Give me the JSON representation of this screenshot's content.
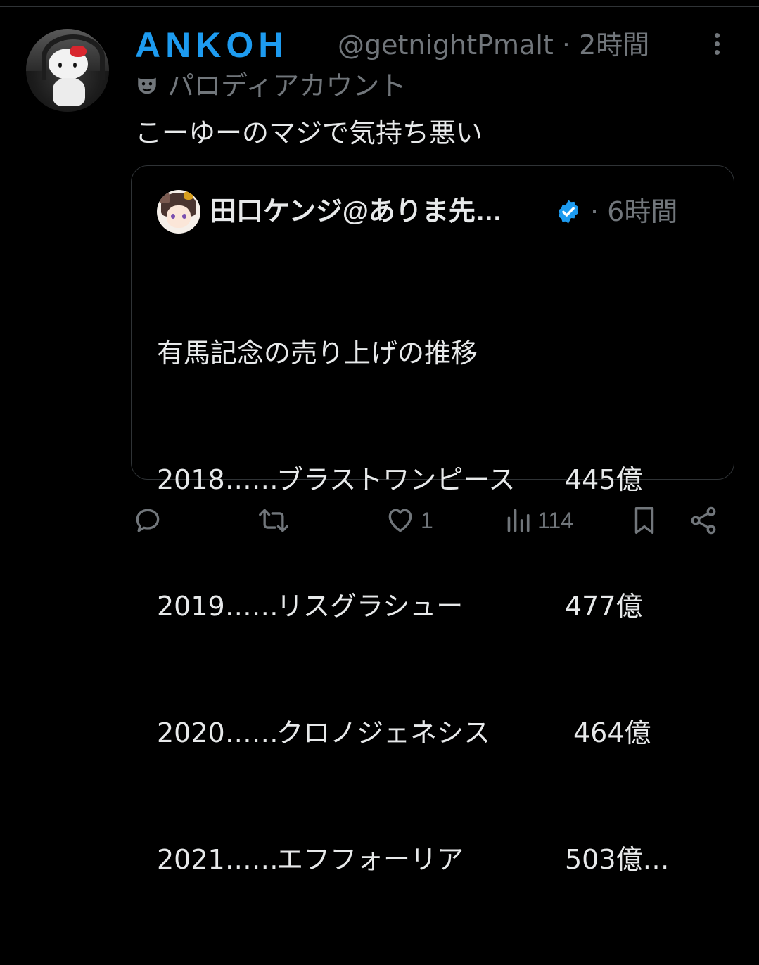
{
  "post": {
    "author": {
      "display_name": "ANKOH",
      "handle": "@getnightPmalt",
      "time": "2時間",
      "label": "パロディアカウント"
    },
    "text": "こーゆーのマジで気持ち悪い",
    "actions": {
      "reply_count": "",
      "repost_count": "",
      "like_count": "1",
      "view_count": "114"
    }
  },
  "quoted": {
    "author": {
      "display_name": "田口ケンジ@ありま先…",
      "time": "6時間",
      "verified_color": "#1d9bf0"
    },
    "heading": "有馬記念の売り上げの推移",
    "rows": [
      {
        "year": "2018……",
        "horse": "ブラストワンピース",
        "value": "445億"
      },
      {
        "year": "2019……",
        "horse": "リスグラシュー",
        "value": "477億"
      },
      {
        "year": "2020……",
        "horse": "クロノジェネシス",
        "value": "464億"
      },
      {
        "year": "2021……",
        "horse": "エフフォーリア",
        "value": "503億…"
      }
    ]
  },
  "colors": {
    "background": "#000000",
    "text": "#e7e9ea",
    "secondary": "#71767b",
    "accent": "#1d9bf0",
    "border": "#2f3336"
  },
  "icons": [
    "more-icon",
    "parody-mask-icon",
    "verified-icon",
    "reply-icon",
    "repost-icon",
    "like-icon",
    "views-icon",
    "bookmark-icon",
    "share-icon"
  ]
}
